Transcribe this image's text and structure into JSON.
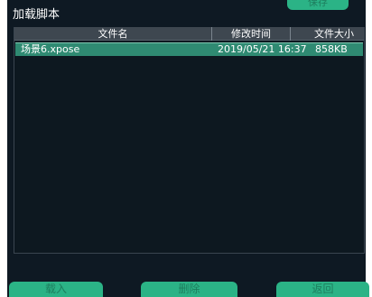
{
  "window": {
    "title": "加载脚本",
    "top_button_label": "保存"
  },
  "table": {
    "columns": [
      "文件名",
      "修改时间",
      "文件大小"
    ],
    "rows": [
      {
        "name": "场景6.xpose",
        "modified": "2019/05/21 16:37",
        "size": "858KB",
        "selected": true
      }
    ]
  },
  "buttons": {
    "load": "载入",
    "delete": "删除",
    "return": "返回"
  },
  "colors": {
    "background": "#0e1923",
    "header": "#3e4750",
    "selected_row": "#2f8a72",
    "button": "#2bb386",
    "button_text": "#1e7e5e"
  }
}
